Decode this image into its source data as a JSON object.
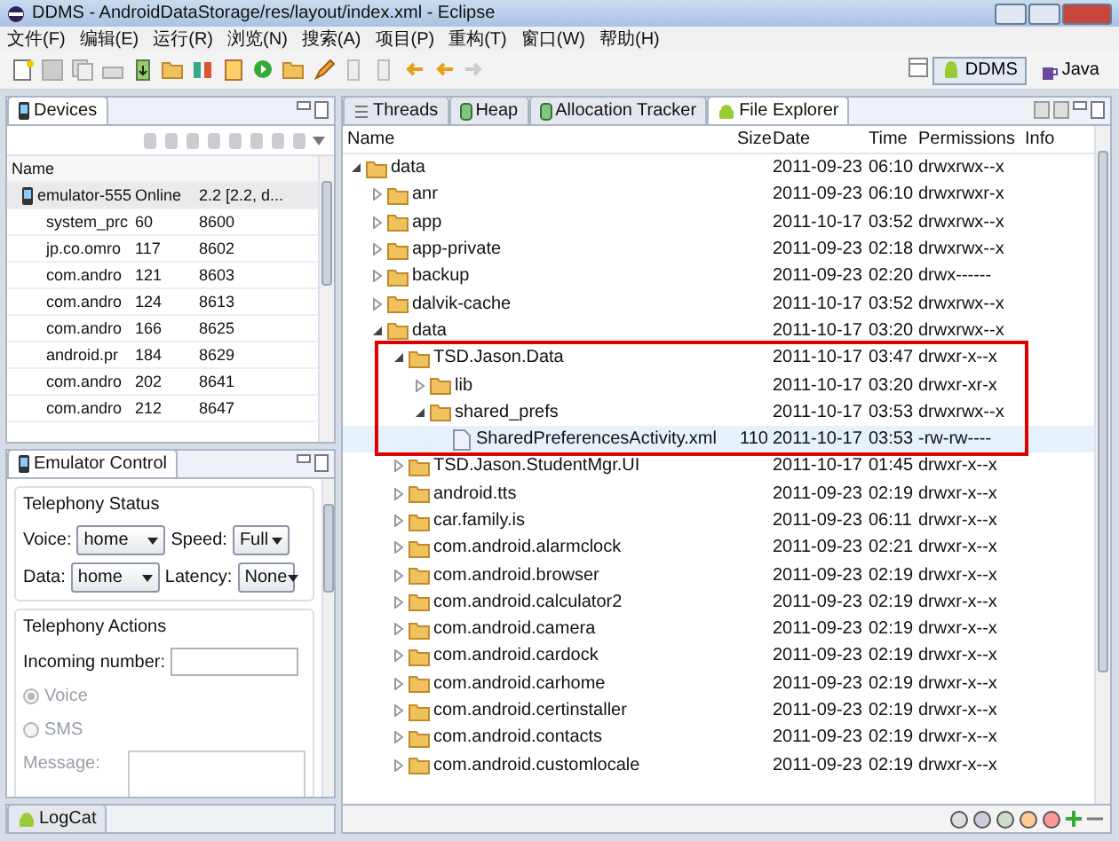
{
  "window": {
    "title": "DDMS - AndroidDataStorage/res/layout/index.xml - Eclipse"
  },
  "menu": [
    "文件(F)",
    "编辑(E)",
    "运行(R)",
    "浏览(N)",
    "搜索(A)",
    "项目(P)",
    "重构(T)",
    "窗口(W)",
    "帮助(H)"
  ],
  "perspectives": [
    {
      "label": "DDMS",
      "selected": true
    },
    {
      "label": "Java",
      "selected": false
    }
  ],
  "devices_view": {
    "tab": "Devices",
    "columns": [
      "Name"
    ],
    "rows": [
      {
        "kind": "device",
        "name": "emulator-555",
        "pid": "Online",
        "port": "2.2 [2.2, d...",
        "selected": true
      },
      {
        "kind": "process",
        "name": "system_prc",
        "pid": "60",
        "port": "8600",
        "selected": false
      },
      {
        "kind": "process",
        "name": "jp.co.omro",
        "pid": "117",
        "port": "8602",
        "selected": false
      },
      {
        "kind": "process",
        "name": "com.andro",
        "pid": "121",
        "port": "8603",
        "selected": false
      },
      {
        "kind": "process",
        "name": "com.andro",
        "pid": "124",
        "port": "8613",
        "selected": false
      },
      {
        "kind": "process",
        "name": "com.andro",
        "pid": "166",
        "port": "8625",
        "selected": false
      },
      {
        "kind": "process",
        "name": "android.pr",
        "pid": "184",
        "port": "8629",
        "selected": false
      },
      {
        "kind": "process",
        "name": "com.andro",
        "pid": "202",
        "port": "8641",
        "selected": false
      },
      {
        "kind": "process",
        "name": "com.andro",
        "pid": "212",
        "port": "8647",
        "selected": false
      }
    ]
  },
  "emulator_control": {
    "tab": "Emulator Control",
    "telephony_status": {
      "title": "Telephony Status",
      "fields": [
        {
          "label": "Voice:",
          "value": "home"
        },
        {
          "label": "Speed:",
          "value": "Full"
        },
        {
          "label": "Data:",
          "value": "home"
        },
        {
          "label": "Latency:",
          "value": "None"
        }
      ]
    },
    "telephony_actions": {
      "title": "Telephony Actions",
      "incoming_label": "Incoming number:",
      "options": [
        {
          "label": "Voice",
          "selected": true,
          "disabled": true
        },
        {
          "label": "SMS",
          "selected": false,
          "disabled": true
        }
      ],
      "message_label": "Message:"
    }
  },
  "bottom_tab": "LogCat",
  "right_tabs": [
    {
      "label": "Threads",
      "selected": false
    },
    {
      "label": "Heap",
      "selected": false
    },
    {
      "label": "Allocation Tracker",
      "selected": false
    },
    {
      "label": "File Explorer",
      "selected": true
    }
  ],
  "file_explorer": {
    "columns": [
      "Name",
      "Size",
      "Date",
      "Time",
      "Permissions",
      "Info"
    ],
    "tree": [
      {
        "kind": "folder",
        "name": "data",
        "date": "2011-09-23",
        "time": "06:10",
        "permissions": "drwxrwx--x",
        "expanded": true,
        "selected": false,
        "framed": false,
        "children": [
          {
            "kind": "folder",
            "name": "anr",
            "date": "2011-09-23",
            "time": "06:10",
            "permissions": "drwxrwxr-x",
            "expanded": false,
            "selected": false,
            "framed": false
          },
          {
            "kind": "folder",
            "name": "app",
            "date": "2011-10-17",
            "time": "03:52",
            "permissions": "drwxrwx--x",
            "expanded": false,
            "selected": false,
            "framed": false
          },
          {
            "kind": "folder",
            "name": "app-private",
            "date": "2011-09-23",
            "time": "02:18",
            "permissions": "drwxrwx--x",
            "expanded": false,
            "selected": false,
            "framed": false
          },
          {
            "kind": "folder",
            "name": "backup",
            "date": "2011-09-23",
            "time": "02:20",
            "permissions": "drwx------",
            "expanded": false,
            "selected": false,
            "framed": false
          },
          {
            "kind": "folder",
            "name": "dalvik-cache",
            "date": "2011-10-17",
            "time": "03:52",
            "permissions": "drwxrwx--x",
            "expanded": false,
            "selected": false,
            "framed": false
          },
          {
            "kind": "folder",
            "name": "data",
            "date": "2011-10-17",
            "time": "03:20",
            "permissions": "drwxrwx--x",
            "expanded": true,
            "selected": false,
            "framed": false,
            "children": [
              {
                "kind": "folder",
                "name": "TSD.Jason.Data",
                "date": "2011-10-17",
                "time": "03:47",
                "permissions": "drwxr-x--x",
                "expanded": true,
                "selected": false,
                "framed": true,
                "children": [
                  {
                    "kind": "folder",
                    "name": "lib",
                    "date": "2011-10-17",
                    "time": "03:20",
                    "permissions": "drwxr-xr-x",
                    "expanded": false,
                    "selected": false,
                    "framed": true
                  },
                  {
                    "kind": "folder",
                    "name": "shared_prefs",
                    "date": "2011-10-17",
                    "time": "03:53",
                    "permissions": "drwxrwx--x",
                    "expanded": true,
                    "selected": false,
                    "framed": true,
                    "children": [
                      {
                        "kind": "file",
                        "name": "SharedPreferencesActivity.xml",
                        "size": "110",
                        "date": "2011-10-17",
                        "time": "03:53",
                        "permissions": "-rw-rw----",
                        "selected": true,
                        "framed": true
                      }
                    ]
                  }
                ]
              },
              {
                "kind": "folder",
                "name": "TSD.Jason.StudentMgr.UI",
                "date": "2011-10-17",
                "time": "01:45",
                "permissions": "drwxr-x--x",
                "expanded": false,
                "selected": false,
                "framed": false
              },
              {
                "kind": "folder",
                "name": "android.tts",
                "date": "2011-09-23",
                "time": "02:19",
                "permissions": "drwxr-x--x",
                "expanded": false,
                "selected": false,
                "framed": false
              },
              {
                "kind": "folder",
                "name": "car.family.is",
                "date": "2011-09-23",
                "time": "06:11",
                "permissions": "drwxr-x--x",
                "expanded": false,
                "selected": false,
                "framed": false
              },
              {
                "kind": "folder",
                "name": "com.android.alarmclock",
                "date": "2011-09-23",
                "time": "02:21",
                "permissions": "drwxr-x--x",
                "expanded": false,
                "selected": false,
                "framed": false
              },
              {
                "kind": "folder",
                "name": "com.android.browser",
                "date": "2011-09-23",
                "time": "02:19",
                "permissions": "drwxr-x--x",
                "expanded": false,
                "selected": false,
                "framed": false
              },
              {
                "kind": "folder",
                "name": "com.android.calculator2",
                "date": "2011-09-23",
                "time": "02:19",
                "permissions": "drwxr-x--x",
                "expanded": false,
                "selected": false,
                "framed": false
              },
              {
                "kind": "folder",
                "name": "com.android.camera",
                "date": "2011-09-23",
                "time": "02:19",
                "permissions": "drwxr-x--x",
                "expanded": false,
                "selected": false,
                "framed": false
              },
              {
                "kind": "folder",
                "name": "com.android.cardock",
                "date": "2011-09-23",
                "time": "02:19",
                "permissions": "drwxr-x--x",
                "expanded": false,
                "selected": false,
                "framed": false
              },
              {
                "kind": "folder",
                "name": "com.android.carhome",
                "date": "2011-09-23",
                "time": "02:19",
                "permissions": "drwxr-x--x",
                "expanded": false,
                "selected": false,
                "framed": false
              },
              {
                "kind": "folder",
                "name": "com.android.certinstaller",
                "date": "2011-09-23",
                "time": "02:19",
                "permissions": "drwxr-x--x",
                "expanded": false,
                "selected": false,
                "framed": false
              },
              {
                "kind": "folder",
                "name": "com.android.contacts",
                "date": "2011-09-23",
                "time": "02:19",
                "permissions": "drwxr-x--x",
                "expanded": false,
                "selected": false,
                "framed": false
              },
              {
                "kind": "folder",
                "name": "com.android.customlocale",
                "date": "2011-09-23",
                "time": "02:19",
                "permissions": "drwxr-x--x",
                "expanded": false,
                "selected": false,
                "framed": false
              }
            ]
          }
        ]
      }
    ]
  }
}
